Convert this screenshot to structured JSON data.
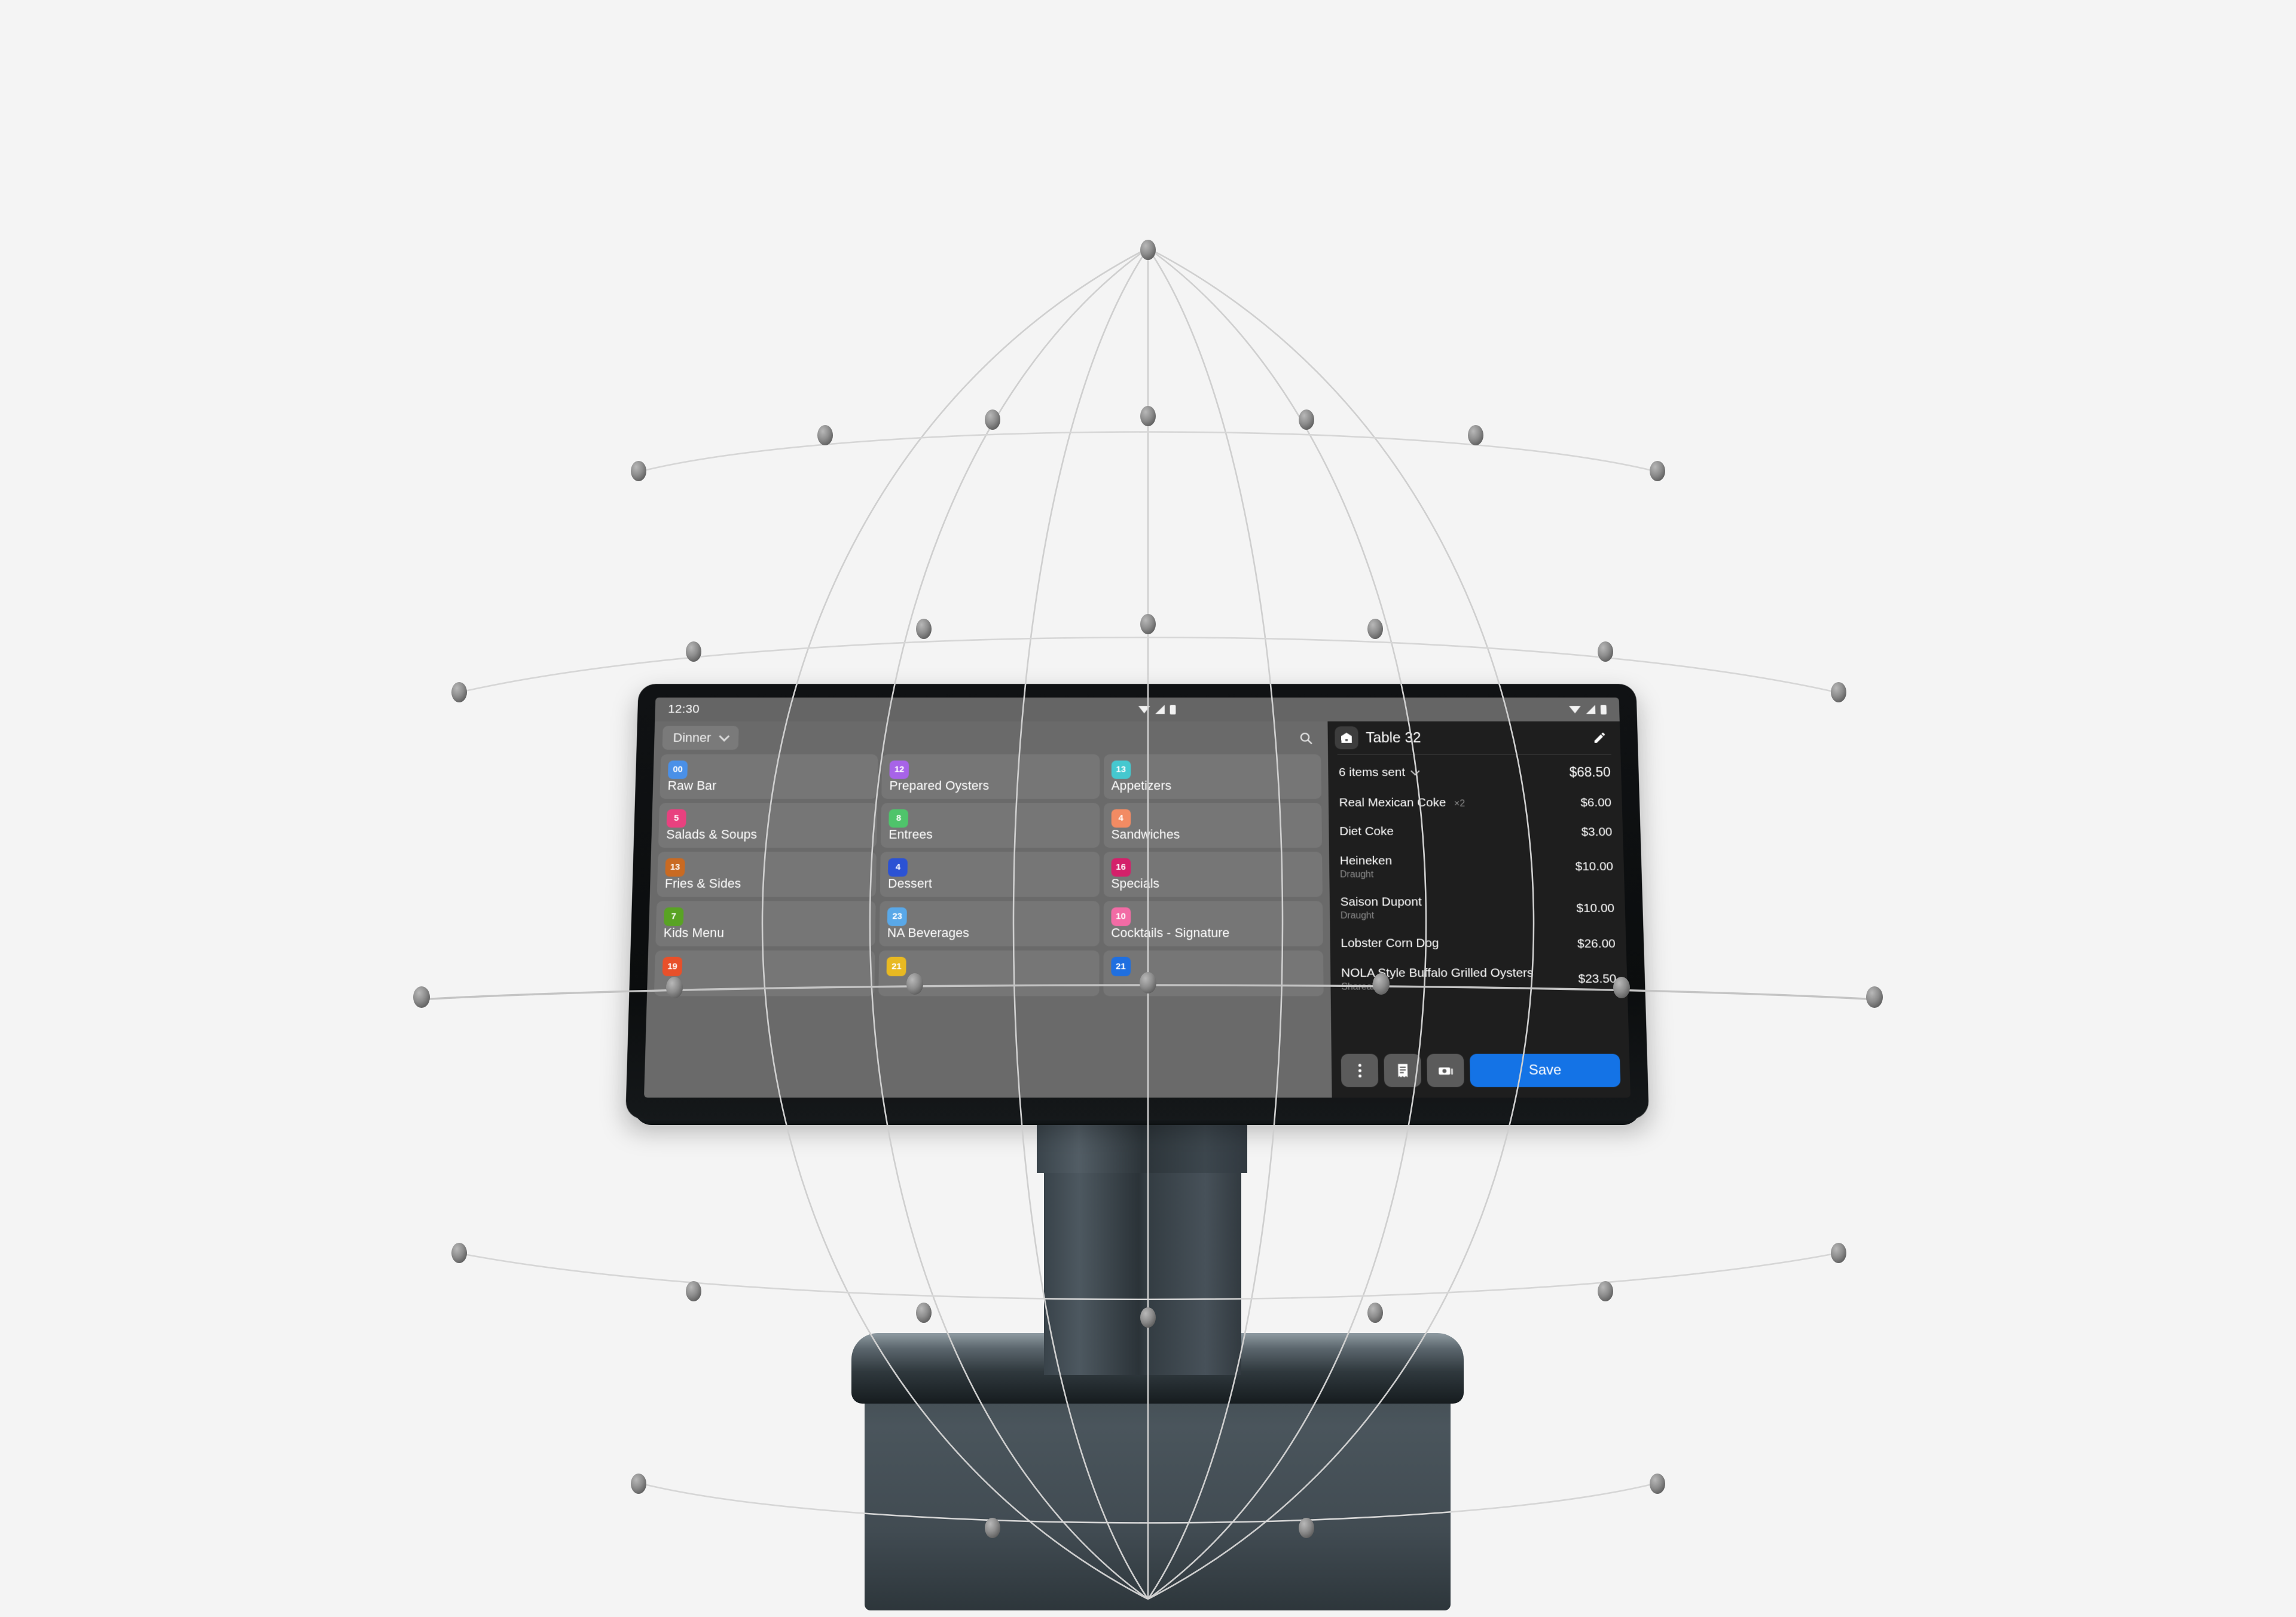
{
  "scene": {
    "background_color": "#f4f4f4",
    "device": "restaurant-pos-tablet-kiosk",
    "decoration": "wireframe-globe"
  },
  "statusbar": {
    "clock": "12:30",
    "icons": [
      "wifi-icon",
      "signal-icon",
      "battery-icon"
    ]
  },
  "menu_pane": {
    "daypart": {
      "label": "Dinner",
      "chevron": "chevron-down-icon"
    },
    "search": {
      "icon": "search-icon"
    },
    "categories": [
      {
        "badge": "00",
        "label": "Raw Bar",
        "color": "#4a90e8"
      },
      {
        "badge": "12",
        "label": "Prepared Oysters",
        "color": "#a763e8"
      },
      {
        "badge": "13",
        "label": "Appetizers",
        "color": "#45c8cf"
      },
      {
        "badge": "5",
        "label": "Salads & Soups",
        "color": "#e8417f"
      },
      {
        "badge": "8",
        "label": "Entrees",
        "color": "#4fc46b"
      },
      {
        "badge": "4",
        "label": "Sandwiches",
        "color": "#f28b63"
      },
      {
        "badge": "13",
        "label": "Fries & Sides",
        "color": "#c96a22"
      },
      {
        "badge": "4",
        "label": "Dessert",
        "color": "#2b52d4"
      },
      {
        "badge": "16",
        "label": "Specials",
        "color": "#d4206a"
      },
      {
        "badge": "7",
        "label": "Kids Menu",
        "color": "#59a324"
      },
      {
        "badge": "23",
        "label": "NA Beverages",
        "color": "#59a8e8"
      },
      {
        "badge": "10",
        "label": "Cocktails - Signature",
        "color": "#f26ba5"
      },
      {
        "badge": "19",
        "label": "",
        "color": "#e8502a"
      },
      {
        "badge": "21",
        "label": "",
        "color": "#e8b922"
      },
      {
        "badge": "21",
        "label": "",
        "color": "#1f6fe0"
      }
    ]
  },
  "order_pane": {
    "header": {
      "table_icon": "table-icon",
      "title": "Table 32",
      "edit_icon": "pencil-icon"
    },
    "summary": {
      "label": "6 items sent",
      "chevron": "chevron-down-icon",
      "total": "$68.50"
    },
    "items": [
      {
        "name": "Real Mexican Coke",
        "qty": "×2",
        "modifier": "",
        "price": "$6.00"
      },
      {
        "name": "Diet Coke",
        "qty": "",
        "modifier": "",
        "price": "$3.00"
      },
      {
        "name": "Heineken",
        "qty": "",
        "modifier": "Draught",
        "price": "$10.00"
      },
      {
        "name": "Saison Dupont",
        "qty": "",
        "modifier": "Draught",
        "price": "$10.00"
      },
      {
        "name": "Lobster Corn Dog",
        "qty": "",
        "modifier": "",
        "price": "$26.00"
      },
      {
        "name": "NOLA Style Buffalo Grilled Oysters",
        "qty": "",
        "modifier": "Shareable",
        "price": "$23.50"
      }
    ],
    "actions": {
      "more_icon": "more-vertical-icon",
      "receipt_icon": "receipt-icon",
      "cash_icon": "cash-icon",
      "save_label": "Save",
      "save_color": "#1473e6"
    }
  }
}
